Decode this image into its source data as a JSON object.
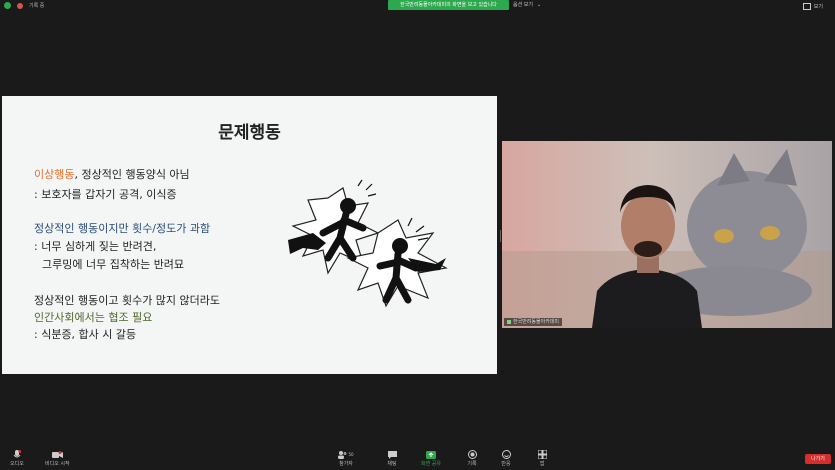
{
  "topbar": {
    "user_label": "기록 중",
    "share_banner": "한국반려동물아카데미의 화면을 보고 있습니다",
    "view_options": "옵션 보기",
    "view_button": "보기"
  },
  "slide": {
    "title": "문제행동",
    "lines": {
      "l1_highlight": "이상행동",
      "l1_rest": ", 정상적인 행동양식 아님",
      "l2": ": 보호자를 갑자기 공격, 이식증",
      "l3": "정상적인 행동이지만 횟수/정도가 과함",
      "l4": ": 너무 심하게 짖는 반려견,",
      "l5": "그루밍에 너무 집착하는 반려묘",
      "l6": "정상적인 행동이고 횟수가 많지 않더라도",
      "l7": "인간사회에서는 협조 필요",
      "l8": ": 식분증, 합사 시 갈등"
    }
  },
  "video": {
    "participant_name": "한국반려동물아카데미"
  },
  "toolbar": {
    "audio": "오디오",
    "video": "비디오 시작",
    "participants": "참가자",
    "participants_count": "50",
    "chat": "채팅",
    "share": "화면 공유",
    "record": "기록",
    "reactions": "반응",
    "apps": "앱",
    "leave": "나가기"
  },
  "colors": {
    "share_green": "#2ea84f",
    "leave_red": "#d62d2d",
    "orange_text": "#e7702b",
    "blue_text": "#2a4d7a",
    "green_text": "#4f6a2d"
  }
}
